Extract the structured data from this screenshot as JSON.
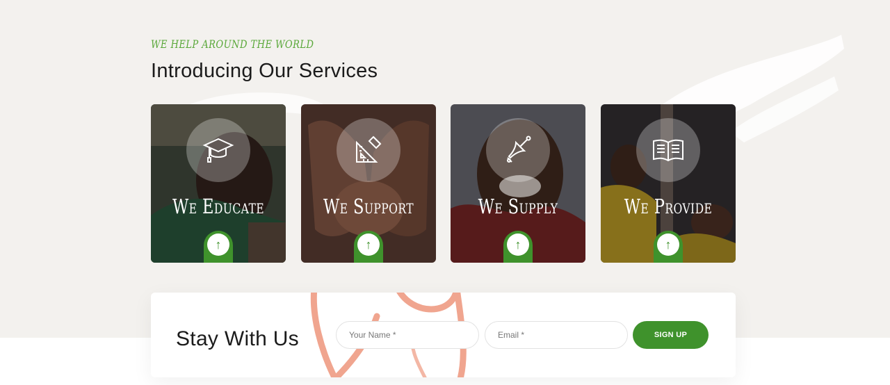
{
  "header": {
    "eyebrow": "WE HELP AROUND THE WORLD",
    "title": "Introducing Our Services"
  },
  "services": [
    {
      "title": "We Educate",
      "icon": "graduation-cap-icon",
      "arrow": "↑"
    },
    {
      "title": "We Support",
      "icon": "ruler-pencil-icon",
      "arrow": "↑"
    },
    {
      "title": "We Supply",
      "icon": "bell-icon",
      "arrow": "↑"
    },
    {
      "title": "We Provide",
      "icon": "open-book-icon",
      "arrow": "↑"
    }
  ],
  "signup": {
    "title": "Stay With Us",
    "name_placeholder": "Your Name *",
    "email_placeholder": "Email *",
    "button_label": "SIGN UP"
  },
  "colors": {
    "accent": "#3f922c",
    "eyebrow": "#5aa83a",
    "background": "#f3f1ee",
    "heart": "#f0a58f"
  }
}
